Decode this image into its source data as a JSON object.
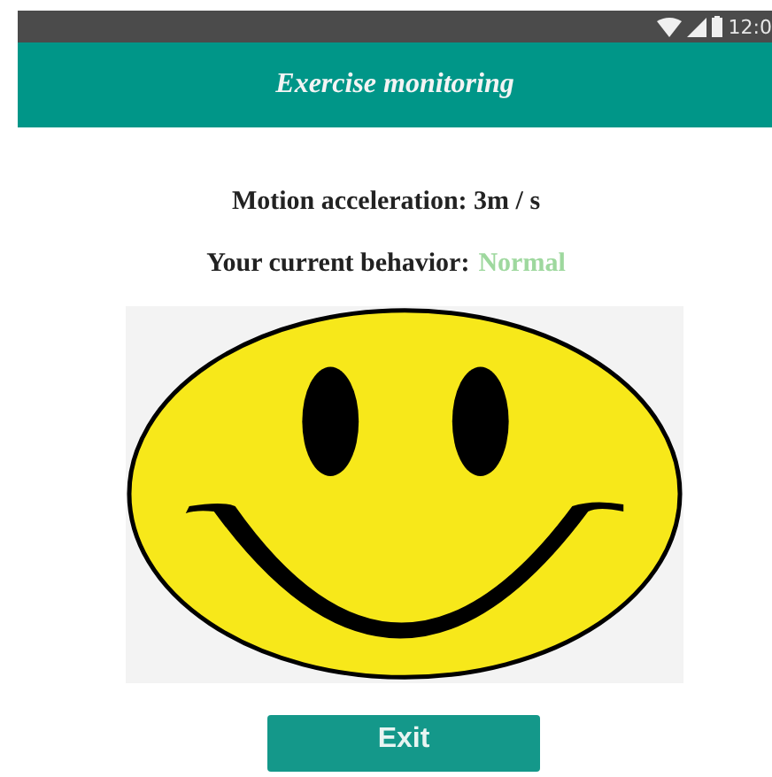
{
  "status_bar": {
    "time": "12:0"
  },
  "app_bar": {
    "title": "Exercise monitoring"
  },
  "acceleration": {
    "text": "Motion acceleration: 3m / s"
  },
  "behavior": {
    "label": "Your current behavior:",
    "value": "Normal"
  },
  "buttons": [
    "Exit"
  ]
}
